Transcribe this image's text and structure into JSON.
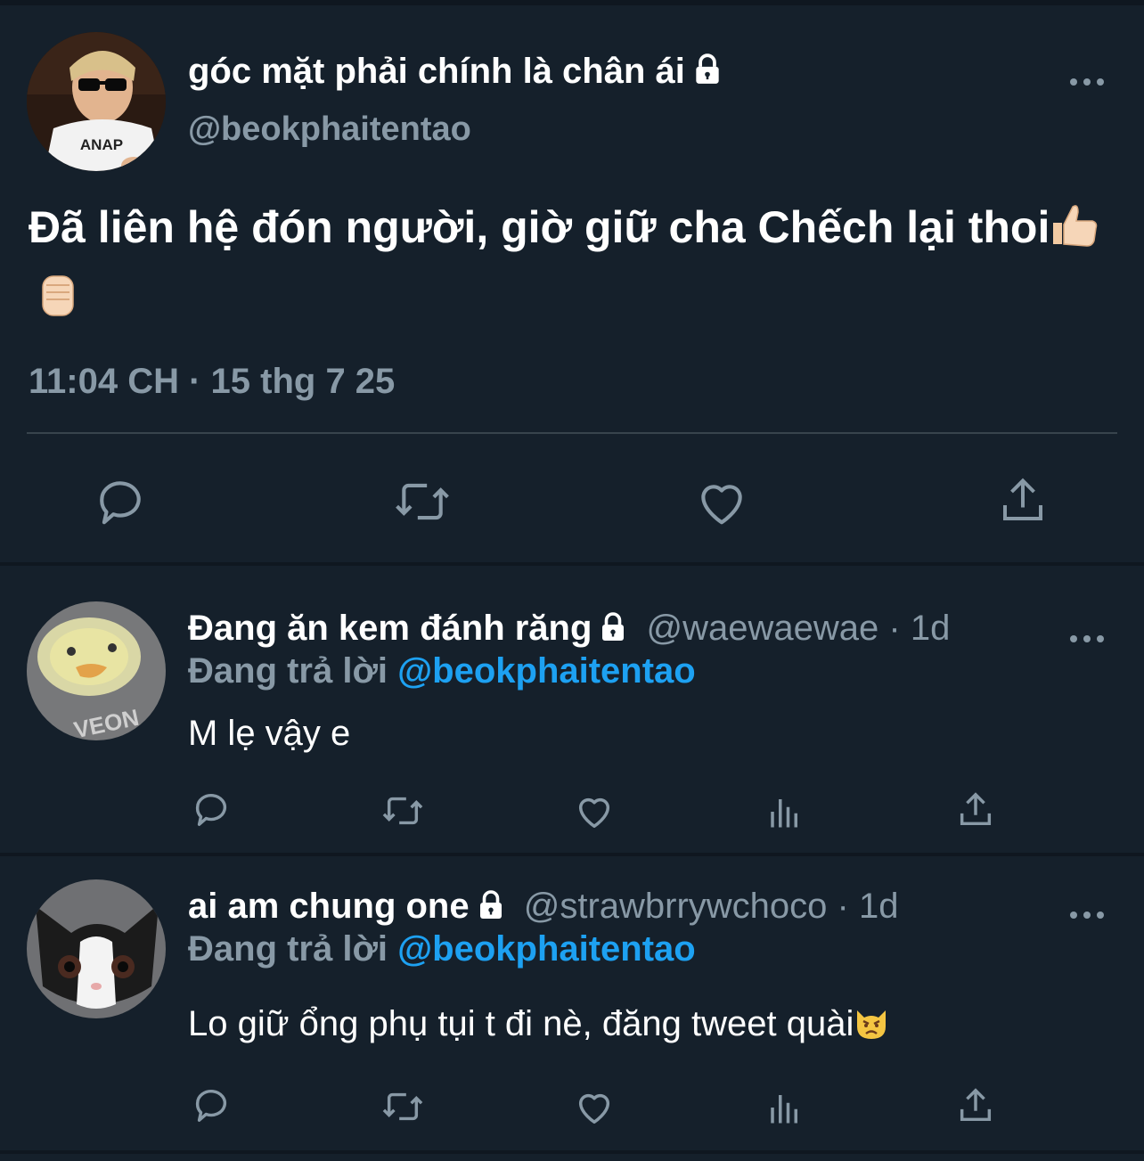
{
  "main_tweet": {
    "author_name": "góc mặt phải chính là chân ái",
    "author_handle": "@beokphaitentao",
    "text": "Đã liên hệ đón người, giờ giữ cha Chếch lại thoi",
    "emojis": [
      "thumbs-up",
      "raised-fist"
    ],
    "timestamp": "11:04 CH · 15 thg 7 25",
    "more_label": "•••",
    "avatar_shirt_text": "ANAP"
  },
  "replies": [
    {
      "author_name": "Đang ăn kem đánh răng",
      "handle": "@waewaewae",
      "time": " · 1d",
      "replying_label": "Đang trả lời ",
      "replying_to": "@beokphaitentao",
      "text": "M lẹ vậy e",
      "more_label": "•••",
      "avatar_text": "VEON"
    },
    {
      "author_name": "ai am chung one",
      "handle": "@strawbrrywchoco",
      "time": " · 1d",
      "replying_label": "Đang trả lời ",
      "replying_to": "@beokphaitentao",
      "text": "Lo giữ ổng phụ tụi t đi nè, đăng tweet quài",
      "more_label": "•••"
    }
  ],
  "colors": {
    "background": "#15202b",
    "secondary_text": "#8899a6",
    "accent": "#1da1f2",
    "divider": "#38444d"
  },
  "icons": [
    "reply-icon",
    "retweet-icon",
    "like-icon",
    "share-icon",
    "analytics-icon",
    "lock-icon",
    "more-icon"
  ]
}
